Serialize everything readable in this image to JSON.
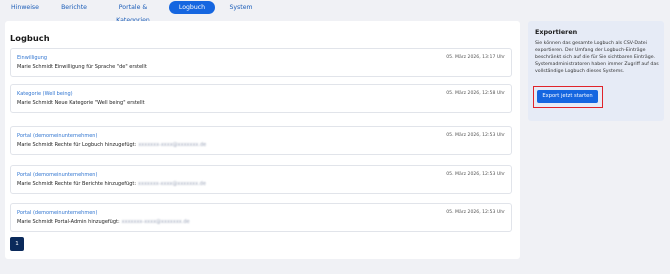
{
  "tabs": [
    {
      "label": "Hinweise",
      "active": false
    },
    {
      "label": "Berichte",
      "active": false
    },
    {
      "label": "Portale & Kategorien",
      "active": false
    },
    {
      "label": "Logbuch",
      "active": true
    },
    {
      "label": "System",
      "active": false
    }
  ],
  "main": {
    "title": "Logbuch",
    "entries": [
      {
        "category": "Einwilligung",
        "date": "05. März 2026, 13:17 Uhr",
        "text": "Marie Schmidt Einwilligung für Sprache \"de\" erstellt",
        "redacted": ""
      },
      {
        "category": "Kategorie (Well being)",
        "date": "05. März 2026, 12:58 Uhr",
        "text": "Marie Schmidt Neue Kategorie \"Well being\" erstellt",
        "redacted": ""
      },
      {
        "category": "Portal (demomeinunternehmen)",
        "date": "05. März 2026, 12:53 Uhr",
        "text": "Marie Schmidt Rechte für Logbuch hinzugefügt:",
        "redacted": "xxxxxxx-xxxx@xxxxxxx.de"
      },
      {
        "category": "Portal (demomeinunternehmen)",
        "date": "05. März 2026, 12:53 Uhr",
        "text": "Marie Schmidt Rechte für Berichte hinzugefügt:",
        "redacted": "xxxxxxx-xxxx@xxxxxxx.de"
      },
      {
        "category": "Portal (demomeinunternehmen)",
        "date": "05. März 2026, 12:53 Uhr",
        "text": "Marie Schmidt Portal-Admin hinzugefügt:",
        "redacted": "xxxxxxx-xxxx@xxxxxxx.de"
      }
    ],
    "pagination": {
      "current_page": "1"
    }
  },
  "export": {
    "title": "Exportieren",
    "description": "Sie können das gesamte Logbuch als CSV-Datei exportieren. Der Umfang der Logbuch-Einträge beschränkt sich auf die für Sie sichtbaren Einträge. Systemadministratoren haben immer Zugriff auf das vollständige Logbuch dieses Systems.",
    "button_label": "Export jetzt starten",
    "highlight_color": "#e0232a"
  },
  "colors": {
    "accent": "#1566e0",
    "link": "#2f74d0",
    "pagination_bg": "#0b2a5b"
  }
}
